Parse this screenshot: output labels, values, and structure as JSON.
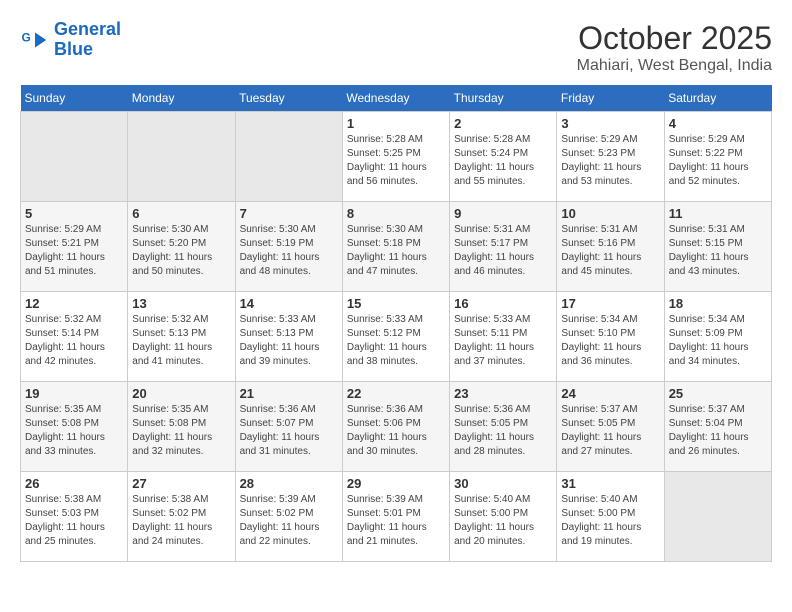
{
  "header": {
    "logo_line1": "General",
    "logo_line2": "Blue",
    "month": "October 2025",
    "location": "Mahiari, West Bengal, India"
  },
  "days_of_week": [
    "Sunday",
    "Monday",
    "Tuesday",
    "Wednesday",
    "Thursday",
    "Friday",
    "Saturday"
  ],
  "weeks": [
    [
      {
        "day": "",
        "info": ""
      },
      {
        "day": "",
        "info": ""
      },
      {
        "day": "",
        "info": ""
      },
      {
        "day": "1",
        "info": "Sunrise: 5:28 AM\nSunset: 5:25 PM\nDaylight: 11 hours\nand 56 minutes."
      },
      {
        "day": "2",
        "info": "Sunrise: 5:28 AM\nSunset: 5:24 PM\nDaylight: 11 hours\nand 55 minutes."
      },
      {
        "day": "3",
        "info": "Sunrise: 5:29 AM\nSunset: 5:23 PM\nDaylight: 11 hours\nand 53 minutes."
      },
      {
        "day": "4",
        "info": "Sunrise: 5:29 AM\nSunset: 5:22 PM\nDaylight: 11 hours\nand 52 minutes."
      }
    ],
    [
      {
        "day": "5",
        "info": "Sunrise: 5:29 AM\nSunset: 5:21 PM\nDaylight: 11 hours\nand 51 minutes."
      },
      {
        "day": "6",
        "info": "Sunrise: 5:30 AM\nSunset: 5:20 PM\nDaylight: 11 hours\nand 50 minutes."
      },
      {
        "day": "7",
        "info": "Sunrise: 5:30 AM\nSunset: 5:19 PM\nDaylight: 11 hours\nand 48 minutes."
      },
      {
        "day": "8",
        "info": "Sunrise: 5:30 AM\nSunset: 5:18 PM\nDaylight: 11 hours\nand 47 minutes."
      },
      {
        "day": "9",
        "info": "Sunrise: 5:31 AM\nSunset: 5:17 PM\nDaylight: 11 hours\nand 46 minutes."
      },
      {
        "day": "10",
        "info": "Sunrise: 5:31 AM\nSunset: 5:16 PM\nDaylight: 11 hours\nand 45 minutes."
      },
      {
        "day": "11",
        "info": "Sunrise: 5:31 AM\nSunset: 5:15 PM\nDaylight: 11 hours\nand 43 minutes."
      }
    ],
    [
      {
        "day": "12",
        "info": "Sunrise: 5:32 AM\nSunset: 5:14 PM\nDaylight: 11 hours\nand 42 minutes."
      },
      {
        "day": "13",
        "info": "Sunrise: 5:32 AM\nSunset: 5:13 PM\nDaylight: 11 hours\nand 41 minutes."
      },
      {
        "day": "14",
        "info": "Sunrise: 5:33 AM\nSunset: 5:13 PM\nDaylight: 11 hours\nand 39 minutes."
      },
      {
        "day": "15",
        "info": "Sunrise: 5:33 AM\nSunset: 5:12 PM\nDaylight: 11 hours\nand 38 minutes."
      },
      {
        "day": "16",
        "info": "Sunrise: 5:33 AM\nSunset: 5:11 PM\nDaylight: 11 hours\nand 37 minutes."
      },
      {
        "day": "17",
        "info": "Sunrise: 5:34 AM\nSunset: 5:10 PM\nDaylight: 11 hours\nand 36 minutes."
      },
      {
        "day": "18",
        "info": "Sunrise: 5:34 AM\nSunset: 5:09 PM\nDaylight: 11 hours\nand 34 minutes."
      }
    ],
    [
      {
        "day": "19",
        "info": "Sunrise: 5:35 AM\nSunset: 5:08 PM\nDaylight: 11 hours\nand 33 minutes."
      },
      {
        "day": "20",
        "info": "Sunrise: 5:35 AM\nSunset: 5:08 PM\nDaylight: 11 hours\nand 32 minutes."
      },
      {
        "day": "21",
        "info": "Sunrise: 5:36 AM\nSunset: 5:07 PM\nDaylight: 11 hours\nand 31 minutes."
      },
      {
        "day": "22",
        "info": "Sunrise: 5:36 AM\nSunset: 5:06 PM\nDaylight: 11 hours\nand 30 minutes."
      },
      {
        "day": "23",
        "info": "Sunrise: 5:36 AM\nSunset: 5:05 PM\nDaylight: 11 hours\nand 28 minutes."
      },
      {
        "day": "24",
        "info": "Sunrise: 5:37 AM\nSunset: 5:05 PM\nDaylight: 11 hours\nand 27 minutes."
      },
      {
        "day": "25",
        "info": "Sunrise: 5:37 AM\nSunset: 5:04 PM\nDaylight: 11 hours\nand 26 minutes."
      }
    ],
    [
      {
        "day": "26",
        "info": "Sunrise: 5:38 AM\nSunset: 5:03 PM\nDaylight: 11 hours\nand 25 minutes."
      },
      {
        "day": "27",
        "info": "Sunrise: 5:38 AM\nSunset: 5:02 PM\nDaylight: 11 hours\nand 24 minutes."
      },
      {
        "day": "28",
        "info": "Sunrise: 5:39 AM\nSunset: 5:02 PM\nDaylight: 11 hours\nand 22 minutes."
      },
      {
        "day": "29",
        "info": "Sunrise: 5:39 AM\nSunset: 5:01 PM\nDaylight: 11 hours\nand 21 minutes."
      },
      {
        "day": "30",
        "info": "Sunrise: 5:40 AM\nSunset: 5:00 PM\nDaylight: 11 hours\nand 20 minutes."
      },
      {
        "day": "31",
        "info": "Sunrise: 5:40 AM\nSunset: 5:00 PM\nDaylight: 11 hours\nand 19 minutes."
      },
      {
        "day": "",
        "info": ""
      }
    ]
  ]
}
